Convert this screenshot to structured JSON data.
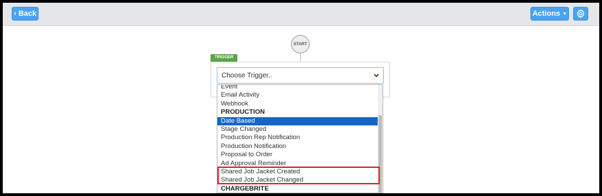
{
  "topbar": {
    "back_label": "Back",
    "actions_label": "Actions",
    "settings_icon": "gear-icon"
  },
  "flow": {
    "start_label": "START",
    "trigger_tag": "TRIGGER"
  },
  "trigger_select": {
    "value": "Choose Trigger.."
  },
  "dropdown": {
    "items": [
      {
        "label": "Event",
        "kind": "option"
      },
      {
        "label": "Email Activity",
        "kind": "option"
      },
      {
        "label": "Webhook",
        "kind": "option"
      },
      {
        "label": "PRODUCTION",
        "kind": "group"
      },
      {
        "label": "Date Based",
        "kind": "option",
        "selected": true
      },
      {
        "label": "Stage Changed",
        "kind": "option"
      },
      {
        "label": "Production Rep Notification",
        "kind": "option"
      },
      {
        "label": "Production Notification",
        "kind": "option"
      },
      {
        "label": "Proposal to Order",
        "kind": "option"
      },
      {
        "label": "Ad Approval Reminder",
        "kind": "option"
      },
      {
        "label": "Shared Job Jacket Created",
        "kind": "option"
      },
      {
        "label": "Shared Job Jacket Changed",
        "kind": "option"
      },
      {
        "label": "CHARGEBRITE",
        "kind": "group"
      }
    ]
  },
  "colors": {
    "accent": "#4aa3f0",
    "trigger_tag": "#5aa54b",
    "selected": "#1565c8",
    "highlight": "#e0222b"
  }
}
